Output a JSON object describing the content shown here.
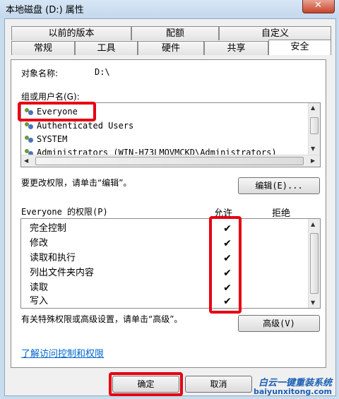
{
  "window": {
    "title": "本地磁盘 (D:) 属性",
    "close_glyph": "✕"
  },
  "tabs_row1": [
    {
      "label": "以前的版本"
    },
    {
      "label": "配额"
    },
    {
      "label": "自定义"
    }
  ],
  "tabs_row2": [
    {
      "label": "常规"
    },
    {
      "label": "工具"
    },
    {
      "label": "硬件"
    },
    {
      "label": "共享"
    },
    {
      "label": "安全",
      "selected": true
    }
  ],
  "object": {
    "label": "对象名称:",
    "value": "D:\\"
  },
  "groups": {
    "label": "组或用户名(G):",
    "users": [
      {
        "name": "Everyone"
      },
      {
        "name": "Authenticated Users"
      },
      {
        "name": "SYSTEM"
      },
      {
        "name": "Administrators (WIN-H73LMOVMCKD\\Administrators)"
      }
    ]
  },
  "edit": {
    "hint": "要更改权限，请单击“编辑”。",
    "button_label": "编辑(E)..."
  },
  "permissions": {
    "header": "Everyone 的权限(P)",
    "allow_label": "允许",
    "deny_label": "拒绝",
    "check_glyph": "✔",
    "rows": [
      {
        "name": "完全控制",
        "allow": true,
        "deny": false
      },
      {
        "name": "修改",
        "allow": true,
        "deny": false
      },
      {
        "name": "读取和执行",
        "allow": true,
        "deny": false
      },
      {
        "name": "列出文件夹内容",
        "allow": true,
        "deny": false
      },
      {
        "name": "读取",
        "allow": true,
        "deny": false
      },
      {
        "name": "写入",
        "allow": true,
        "deny": false
      }
    ]
  },
  "advanced": {
    "hint": "有关特殊权限或高级设置，请单击“高级”。",
    "button_label": "高级(V)"
  },
  "link": {
    "text": "了解访问控制和权限"
  },
  "footer": {
    "ok_label": "确定",
    "cancel_label": "取消"
  },
  "watermark": {
    "brand": "白云一键重装系统",
    "url": "baiyunxitong.com"
  },
  "colors": {
    "highlight": "#e60012",
    "link": "#0066cc",
    "brand": "#1a5fb4"
  }
}
